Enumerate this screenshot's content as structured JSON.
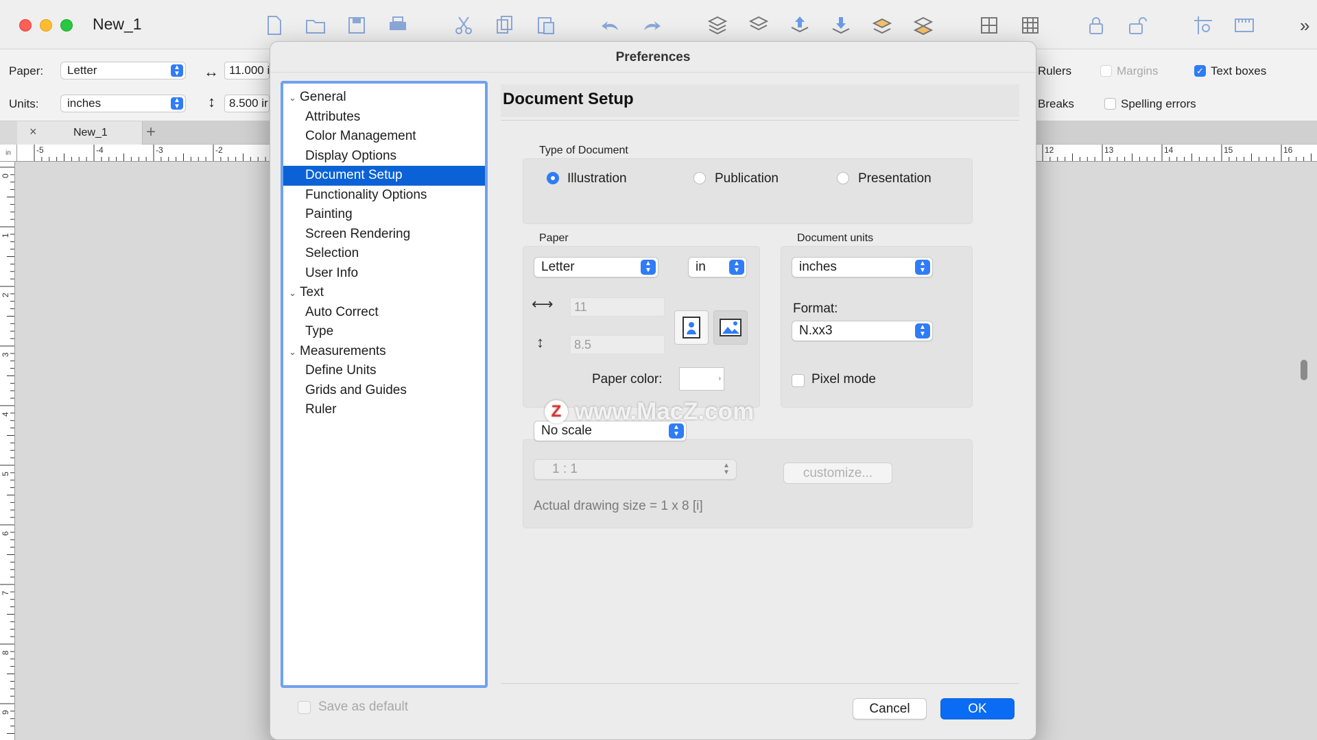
{
  "window": {
    "title": "New_1"
  },
  "toolbar": {
    "icons": [
      "new-document-icon",
      "open-folder-icon",
      "save-icon",
      "print-icon",
      "cut-icon",
      "copy-icon",
      "paste-icon",
      "undo-icon",
      "redo-icon",
      "layers-icon",
      "layers-alt-icon",
      "layer-up-icon",
      "layer-down-icon",
      "layer-front-icon",
      "layer-back-icon",
      "grid-icon",
      "grid-alt-icon",
      "lock-icon",
      "unlock-icon",
      "guide-icon",
      "ruler-icon"
    ],
    "overflow": "»"
  },
  "options": {
    "paper_label": "Paper:",
    "paper_value": "Letter",
    "units_label": "Units:",
    "units_value": "inches",
    "width_value": "11.000 i",
    "height_value": "8.500 ir",
    "rulers_label": "Rulers",
    "margins_label": "Margins",
    "text_boxes_label": "Text boxes",
    "breaks_label": "Breaks",
    "spelling_label": "Spelling errors"
  },
  "tabs": {
    "doc_tab": "New_1",
    "close": "×",
    "add": "+"
  },
  "ruler": {
    "h_left": [
      "-5",
      "-4",
      "-3",
      "-2"
    ],
    "h_right": [
      "12",
      "13",
      "14",
      "15",
      "16"
    ],
    "v": [
      "0",
      "1",
      "2",
      "3",
      "4",
      "5",
      "6",
      "7",
      "8",
      "9"
    ],
    "corner": "in"
  },
  "dialog": {
    "title": "Preferences",
    "tree": [
      {
        "label": "General",
        "level": 0,
        "expanded": true
      },
      {
        "label": "Attributes",
        "level": 1
      },
      {
        "label": "Color Management",
        "level": 1
      },
      {
        "label": "Display Options",
        "level": 1
      },
      {
        "label": "Document Setup",
        "level": 1,
        "selected": true
      },
      {
        "label": "Functionality Options",
        "level": 1
      },
      {
        "label": "Painting",
        "level": 1
      },
      {
        "label": "Screen Rendering",
        "level": 1
      },
      {
        "label": "Selection",
        "level": 1
      },
      {
        "label": "User Info",
        "level": 1
      },
      {
        "label": "Text",
        "level": 0,
        "expanded": true
      },
      {
        "label": "Auto Correct",
        "level": 1
      },
      {
        "label": "Type",
        "level": 1
      },
      {
        "label": "Measurements",
        "level": 0,
        "expanded": true
      },
      {
        "label": "Define Units",
        "level": 1
      },
      {
        "label": "Grids and Guides",
        "level": 1
      },
      {
        "label": "Ruler",
        "level": 1
      }
    ],
    "save_default_label": "Save as default",
    "panel_title": "Document Setup",
    "type_of_document": {
      "label": "Type of Document",
      "options": [
        "Illustration",
        "Publication",
        "Presentation"
      ],
      "selected": "Illustration"
    },
    "paper": {
      "label": "Paper",
      "size_value": "Letter",
      "unit_value": "in",
      "width_value": "11",
      "height_value": "8.5",
      "color_label": "Paper color:",
      "color_value": "#ffffff"
    },
    "document_units": {
      "label": "Document units",
      "value": "inches",
      "format_label": "Format:",
      "format_value": "N.xx3",
      "pixel_mode_label": "Pixel mode"
    },
    "scale": {
      "value": "No scale",
      "ratio_value": "1 : 1",
      "customize_label": "customize...",
      "actual_size_text": "Actual drawing size = 1 x 8 [i]"
    },
    "buttons": {
      "cancel": "Cancel",
      "ok": "OK"
    }
  },
  "watermark": {
    "text": "www.MacZ.com",
    "logo": "Z"
  },
  "colors": {
    "accent": "#2f7cf6",
    "selection": "#0a62d6"
  }
}
